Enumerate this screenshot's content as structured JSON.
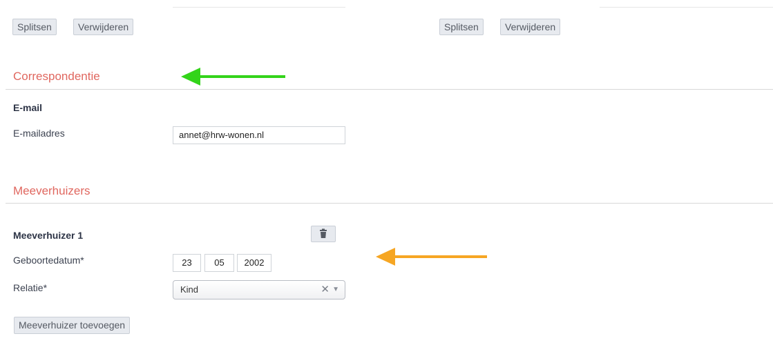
{
  "buttons": {
    "split_label": "Splitsen",
    "delete_label": "Verwijderen",
    "add_mover_label": "Meeverhuizer toevoegen"
  },
  "correspondence": {
    "title": "Correspondentie",
    "email_heading": "E-mail",
    "email_label": "E-mailadres",
    "email_value": "annet@hrw-wonen.nl"
  },
  "movers": {
    "title": "Meeverhuizers",
    "item_title": "Meeverhuizer 1",
    "birth_label": "Geboortedatum*",
    "birth_day": "23",
    "birth_month": "05",
    "birth_year": "2002",
    "relation_label": "Relatie*",
    "relation_value": "Kind",
    "delete_icon": "trash-icon",
    "clear_icon": "close-icon",
    "dropdown_icon": "chevron-down-icon"
  },
  "annotations": {
    "green_arrow_color": "#33d41a",
    "orange_arrow_color": "#f6a623"
  },
  "colors": {
    "section_title": "#e0675f",
    "button_bg": "#e7eaef"
  }
}
